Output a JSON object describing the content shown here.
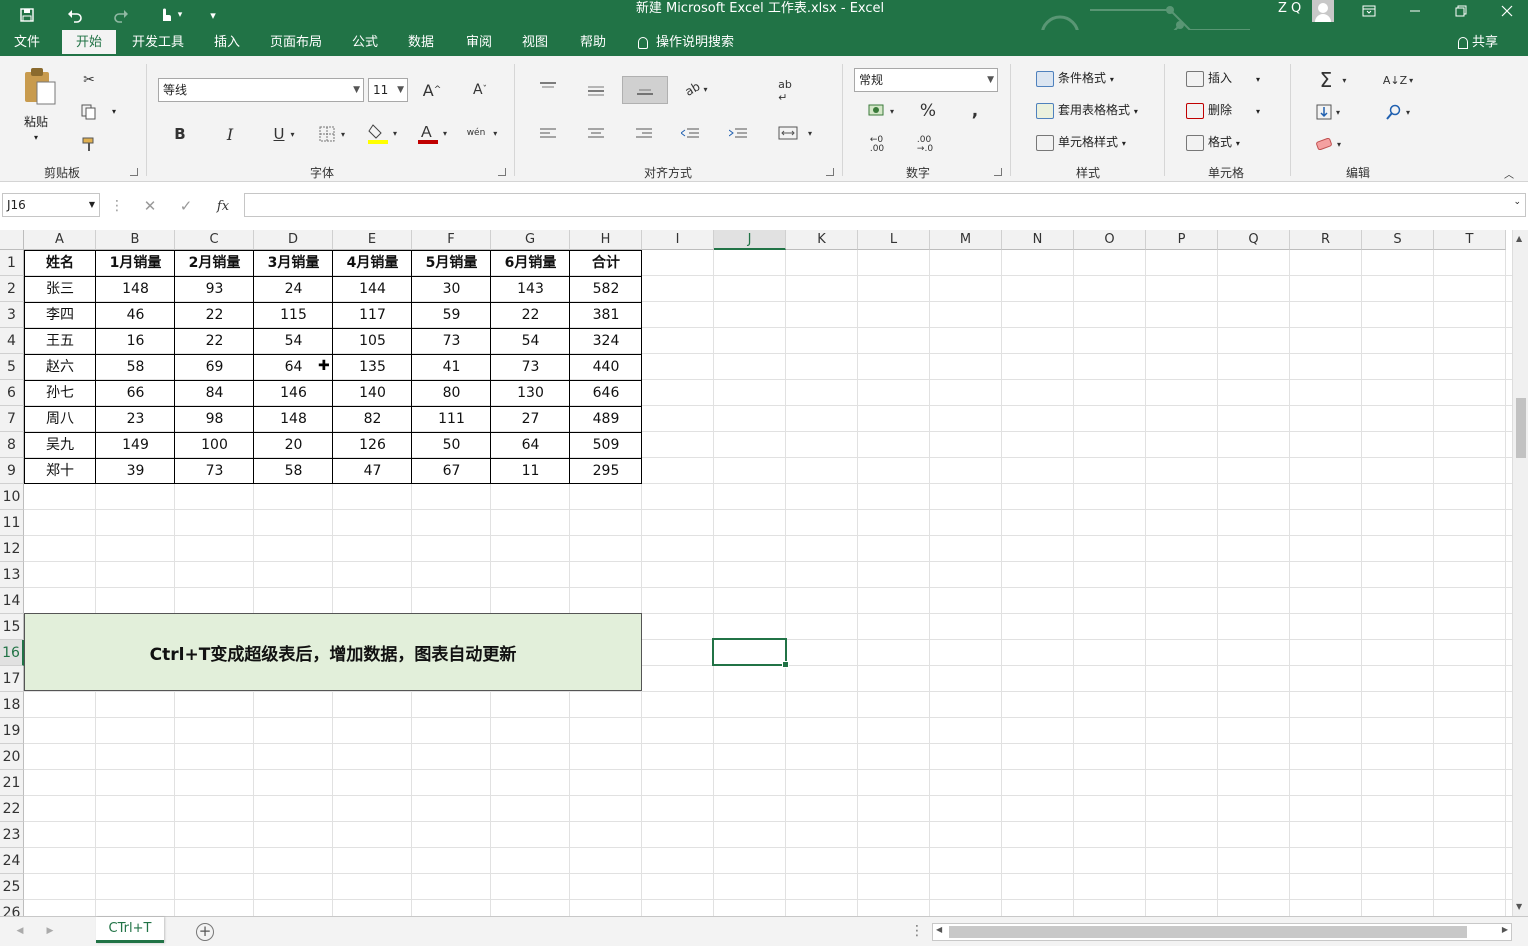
{
  "window": {
    "title": "新建 Microsoft Excel 工作表.xlsx  -  Excel",
    "user": "Z Q"
  },
  "menu": {
    "tabs": [
      "文件",
      "开始",
      "开发工具",
      "插入",
      "页面布局",
      "公式",
      "数据",
      "审阅",
      "视图",
      "帮助"
    ],
    "search": "操作说明搜索",
    "share": "共享"
  },
  "ribbon": {
    "clipboard": {
      "paste": "粘贴",
      "label": "剪贴板"
    },
    "font": {
      "family": "等线",
      "size": "11",
      "label": "字体"
    },
    "alignment": {
      "label": "对齐方式"
    },
    "number": {
      "format": "常规",
      "label": "数字"
    },
    "styles": {
      "conditional": "条件格式",
      "table_format": "套用表格格式",
      "cell_styles": "单元格样式",
      "label": "样式"
    },
    "cells": {
      "insert": "插入",
      "delete": "删除",
      "format": "格式",
      "label": "单元格"
    },
    "editing": {
      "label": "编辑"
    }
  },
  "formula_bar": {
    "name_box": "J16",
    "formula": ""
  },
  "columns": [
    "A",
    "B",
    "C",
    "D",
    "E",
    "F",
    "G",
    "H",
    "I",
    "J",
    "K",
    "L",
    "M",
    "N",
    "O",
    "P",
    "Q",
    "R",
    "S",
    "T"
  ],
  "rows": [
    "1",
    "2",
    "3",
    "4",
    "5",
    "6",
    "7",
    "8",
    "9",
    "10",
    "11",
    "12",
    "13",
    "14",
    "15",
    "16",
    "17",
    "18",
    "19",
    "20",
    "21",
    "22",
    "23",
    "24",
    "25",
    "26"
  ],
  "table": {
    "headers": [
      "姓名",
      "1月销量",
      "2月销量",
      "3月销量",
      "4月销量",
      "5月销量",
      "6月销量",
      "合计"
    ],
    "rows": [
      [
        "张三",
        "148",
        "93",
        "24",
        "144",
        "30",
        "143",
        "582"
      ],
      [
        "李四",
        "46",
        "22",
        "115",
        "117",
        "59",
        "22",
        "381"
      ],
      [
        "王五",
        "16",
        "22",
        "54",
        "105",
        "73",
        "54",
        "324"
      ],
      [
        "赵六",
        "58",
        "69",
        "64",
        "135",
        "41",
        "73",
        "440"
      ],
      [
        "孙七",
        "66",
        "84",
        "146",
        "140",
        "80",
        "130",
        "646"
      ],
      [
        "周八",
        "23",
        "98",
        "148",
        "82",
        "111",
        "27",
        "489"
      ],
      [
        "吴九",
        "149",
        "100",
        "20",
        "126",
        "50",
        "64",
        "509"
      ],
      [
        "郑十",
        "39",
        "73",
        "58",
        "47",
        "67",
        "11",
        "295"
      ]
    ]
  },
  "note": "Ctrl+T变成超级表后，增加数据，图表自动更新",
  "selected_cell": "J16",
  "sheet": {
    "tabs": [
      "CTrl+T"
    ]
  },
  "colors": {
    "accent": "#217346",
    "note_fill": "#e2efda"
  }
}
